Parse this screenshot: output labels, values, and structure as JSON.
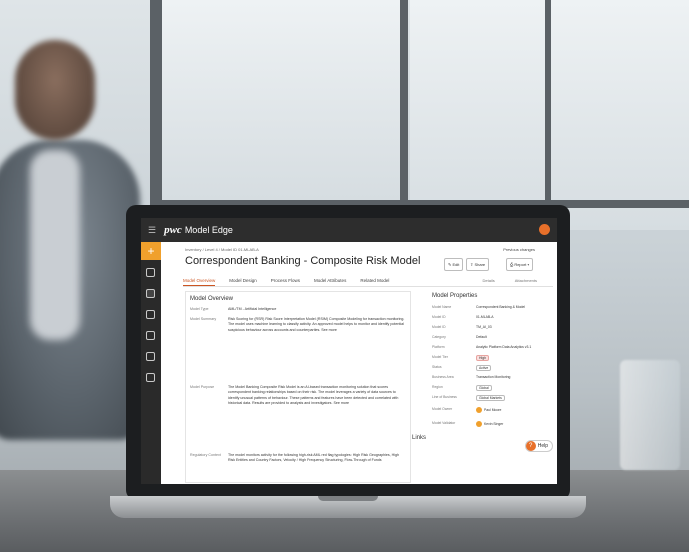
{
  "app": {
    "logo": "pwc",
    "name": "Model Edge"
  },
  "breadcrumb": "Inventory  /  Level 4  /  Model ID 01-MLAB-A",
  "previous_changes": "Previous changes",
  "title": "Correspondent Banking - Composite Risk Model",
  "buttons": {
    "edit": "Edit",
    "share": "Share",
    "report": "Report"
  },
  "tabs": [
    "Model Overview",
    "Model Design",
    "Process Flows",
    "Model Attributes",
    "Related Model"
  ],
  "right_tabs": [
    "Details",
    "Attachments"
  ],
  "overview": {
    "title": "Model Overview",
    "rows": [
      {
        "key": "Model Type",
        "value": "AML/TM - Artificial Intelligence"
      },
      {
        "key": "Model Summary",
        "value": "Risk Scoring for (RSR) Risk Score Interpretation Model (RSIM) Composite Modeling for transaction monitoring. The model uses machine learning to classify activity. An approved model helps to monitor and identify potential suspicious behaviour across accounts and counterparties. See more"
      },
      {
        "key": "Model Purpose",
        "value": "The Model Banking Composite Risk Model is an AI-based transaction monitoring solution that scores correspondent banking relationships based on their risk. The model leverages a variety of data sources to identify unusual patterns of behaviour. These patterns and features have been detected and correlated with historical data. Results are provided to analysts and investigators. See more"
      },
      {
        "key": "Regulatory Context",
        "value": "The model monitors activity for the following high-risk AML red flag typologies: High Risk Geographies, High Risk Entities and Country Factors, Velocity / High Frequency Structuring, Flow-Through of Funds"
      }
    ]
  },
  "properties": {
    "title": "Model Properties",
    "rows": [
      {
        "key": "Model Name",
        "value": "Correspondent Banking & Model"
      },
      {
        "key": "Model ID",
        "value": "01-MLAB-A"
      },
      {
        "key": "Model ID",
        "value": "TM_AI_03"
      },
      {
        "key": "Category",
        "value": "Default"
      },
      {
        "key": "Platform",
        "value": "Analytic Platform Data Analytics v3.1"
      },
      {
        "key": "Model Tier",
        "value": "High"
      },
      {
        "key": "Status",
        "value": "Active"
      },
      {
        "key": "Business Area",
        "value": "Transaction Monitoring"
      },
      {
        "key": "Region",
        "value": "Global"
      },
      {
        "key": "Line of Business",
        "value": "Global Markets"
      },
      {
        "key": "Model Owner",
        "value": "Paul Moore"
      },
      {
        "key": "Model Validator",
        "value": "Kevin Singer"
      }
    ]
  },
  "links_title": "Links",
  "help_label": "Help"
}
